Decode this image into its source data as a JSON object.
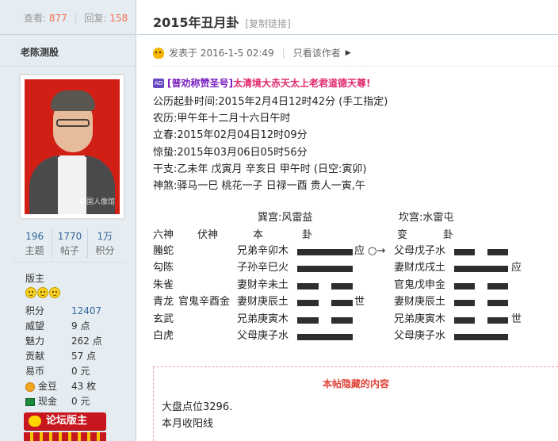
{
  "sidebar": {
    "views_label": "查看:",
    "views": "877",
    "replies_label": "回复:",
    "replies": "158",
    "username": "老陈测股",
    "avatar_watermark": "中国人像馆",
    "counts": [
      {
        "value": "196",
        "label": "主题"
      },
      {
        "value": "1770",
        "label": "帖子"
      },
      {
        "value": "1万",
        "label": "积分"
      }
    ],
    "role": "版主",
    "info": [
      {
        "key": "积分",
        "value": "12407",
        "link": true
      },
      {
        "key": "威望",
        "value": "9 点"
      },
      {
        "key": "魅力",
        "value": "262 点"
      },
      {
        "key": "贡献",
        "value": "57 点"
      },
      {
        "key": "易币",
        "value": "0 元"
      },
      {
        "key": "金豆",
        "value": "43 枚",
        "icon": "coin-icon"
      },
      {
        "key": "现金",
        "value": "0 元",
        "icon": "cash-icon"
      }
    ],
    "badge": "论坛版主"
  },
  "post": {
    "title": "2015年丑月卦",
    "permalink": "[复制链接]",
    "posted": "发表于 2016-1-5 02:49",
    "author_only": "只看该作者",
    "ad_icon": "AD",
    "ad_pre": "[普劝称赞圣号]",
    "ad_mid": "太清境大赤天太上老君道德天尊",
    "ad_end": "!",
    "lines": [
      "公历起卦时间:2015年2月4日12时42分  (手工指定)",
      "农历:甲午年十二月十六日午时",
      "立春:2015年02月04日12时09分",
      "惊蛰:2015年03月06日05时56分",
      "干支:乙未年  戊寅月  辛亥日  甲午时      (日空:寅卯)",
      "神煞:驿马一巳  桃花一子  日禄一酉  贵人一寅,午"
    ],
    "hexagram": {
      "left_palace": "巽宫:风雷益",
      "right_palace": "坎宫:水雷屯",
      "headers": {
        "six_gods": "六神",
        "hidden": "伏神",
        "ben": "本",
        "gua": "卦",
        "bian": "变",
        "gua2": "卦"
      },
      "rows": [
        {
          "god": "螣蛇",
          "hidden": "",
          "ben": "兄弟辛卯木",
          "ben_line": "yang",
          "mark": "应 ○→",
          "bian": "父母戊子水",
          "bian_line": "yin",
          "bian_mark": ""
        },
        {
          "god": "勾陈",
          "hidden": "",
          "ben": "子孙辛巳火",
          "ben_line": "yang",
          "mark": "",
          "bian": "妻财戊戌土",
          "bian_line": "yang",
          "bian_mark": "应"
        },
        {
          "god": "朱雀",
          "hidden": "",
          "ben": "妻财辛未土",
          "ben_line": "yin",
          "mark": "",
          "bian": "官鬼戊申金",
          "bian_line": "yin",
          "bian_mark": ""
        },
        {
          "god": "青龙",
          "hidden": "官鬼辛酉金",
          "ben": "妻财庚辰土",
          "ben_line": "yin",
          "mark": "世",
          "bian": "妻财庚辰土",
          "bian_line": "yin",
          "bian_mark": ""
        },
        {
          "god": "玄武",
          "hidden": "",
          "ben": "兄弟庚寅木",
          "ben_line": "yin",
          "mark": "",
          "bian": "兄弟庚寅木",
          "bian_line": "yin",
          "bian_mark": "世"
        },
        {
          "god": "白虎",
          "hidden": "",
          "ben": "父母庚子水",
          "ben_line": "yang",
          "mark": "",
          "bian": "父母庚子水",
          "bian_line": "yang",
          "bian_mark": ""
        }
      ]
    },
    "hidden": {
      "title": "本帖隐藏的内容",
      "lines": [
        "大盘点位3296.",
        "本月收阳线"
      ]
    }
  },
  "colors": {
    "sidebar_bg": "#e5edf2",
    "accent_link": "#336699",
    "count_red": "#f26c4f",
    "hidden_title": "#e0463a"
  }
}
